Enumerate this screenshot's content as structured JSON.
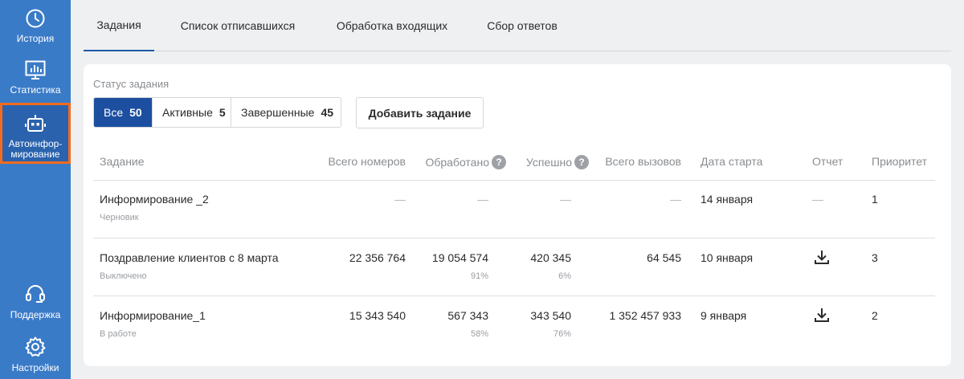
{
  "sidebar": {
    "history": "История",
    "stats": "Статистика",
    "auto": "Автоинфор-\nмирование",
    "support": "Поддержка",
    "settings": "Настройки"
  },
  "tabs": [
    "Задания",
    "Список отписавшихся",
    "Обработка входящих",
    "Сбор ответов"
  ],
  "filters": {
    "label": "Статус задания",
    "items": [
      {
        "label": "Все",
        "count": "50"
      },
      {
        "label": "Активные",
        "count": "5"
      },
      {
        "label": "Завершенные",
        "count": "45"
      }
    ],
    "add_button": "Добавить задание"
  },
  "columns": {
    "task": "Задание",
    "total_numbers": "Всего номеров",
    "processed": "Обработано",
    "success": "Успешно",
    "total_calls": "Всего вызовов",
    "start_date": "Дата старта",
    "report": "Отчет",
    "priority": "Приоритет",
    "help_glyph": "?"
  },
  "rows": [
    {
      "name": "Информирование _2",
      "status": "Черновик",
      "total_numbers": "—",
      "processed": "—",
      "processed_pct": "",
      "success": "—",
      "success_pct": "",
      "total_calls": "—",
      "start_date": "14 января",
      "report": "—",
      "priority": "1"
    },
    {
      "name": "Поздравление клиентов с 8 марта",
      "status": "Выключено",
      "total_numbers": "22 356 764",
      "processed": "19 054 574",
      "processed_pct": "91%",
      "success": "420 345",
      "success_pct": "6%",
      "total_calls": "64 545",
      "start_date": "10 января",
      "report": "download-icon",
      "priority": "3"
    },
    {
      "name": "Информирование_1",
      "status": "В работе",
      "total_numbers": "15 343 540",
      "processed": "567 343",
      "processed_pct": "58%",
      "success": "343 540",
      "success_pct": "76%",
      "total_calls": "1 352 457 933",
      "start_date": "9 января",
      "report": "download-icon",
      "priority": "2"
    }
  ],
  "colors": {
    "sidebar": "#3a7bc8",
    "sidebar_active": "#2a62ad",
    "highlight": "#f26b1d",
    "accent": "#1d4fa0"
  }
}
